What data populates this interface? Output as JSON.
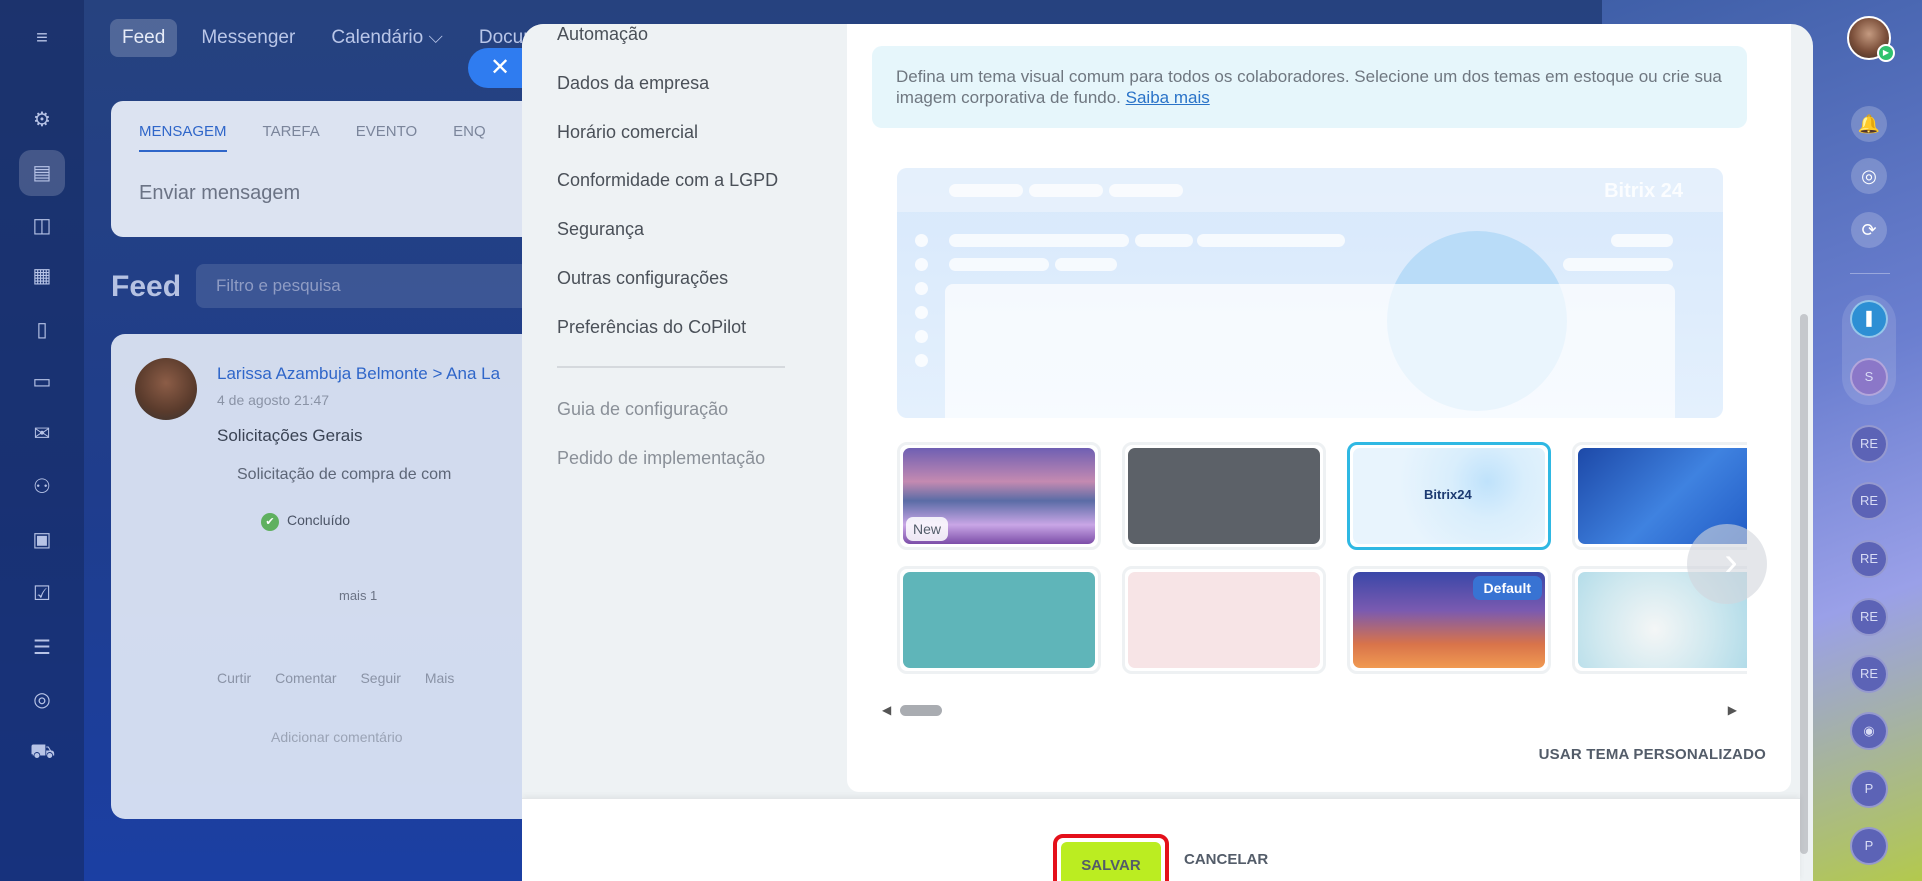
{
  "colors": {
    "accent": "#2fb8e3",
    "save_button": "#bbed21",
    "highlight_box": "#e4101a",
    "link": "#2a73c8",
    "default_badge": "#3873d3"
  },
  "background": {
    "topnav": [
      "Feed",
      "Messenger",
      "Calendário ⌵",
      "Docume"
    ],
    "composer": {
      "tabs": [
        "MENSAGEM",
        "TAREFA",
        "EVENTO",
        "ENQ"
      ],
      "placeholder": "Enviar mensagem"
    },
    "feed": {
      "title": "Feed",
      "filter_placeholder": "Filtro e pesquisa"
    },
    "post": {
      "author": "Larissa Azambuja Belmonte  >  Ana La",
      "date": "4 de agosto 21:47",
      "title": "Solicitações Gerais",
      "request": "Solicitação de compra de com",
      "status": "Concluído",
      "more": "mais 1",
      "actions": "Curtir Comentar Seguir Mais",
      "reply_placeholder": "Adicionar comentário"
    },
    "right_rail": {
      "chip_s": "S",
      "chips_re": [
        "RE",
        "RE",
        "RE",
        "RE",
        "RE"
      ],
      "chips_p": [
        "P",
        "P"
      ]
    }
  },
  "settings_menu": {
    "items": [
      "Automação",
      "Dados da empresa",
      "Horário comercial",
      "Conformidade com a LGPD",
      "Segurança",
      "Outras configurações",
      "Preferências do CoPilot"
    ],
    "secondary_items": [
      "Guia de configuração",
      "Pedido de implementação"
    ]
  },
  "theme_panel": {
    "info_text": "Defina um tema visual comum para todos os colaboradores. Selecione um dos temas em estoque ou crie sua imagem corporativa de fundo.",
    "info_link": "Saiba mais",
    "preview_logo": "Bitrix 24",
    "selected_theme_logo": "Bitrix24",
    "badge_new": "New",
    "badge_default": "Default",
    "custom_theme_link": "USAR TEMA PERSONALIZADO"
  },
  "footer": {
    "save_label": "SALVAR",
    "cancel_label": "CANCELAR"
  }
}
